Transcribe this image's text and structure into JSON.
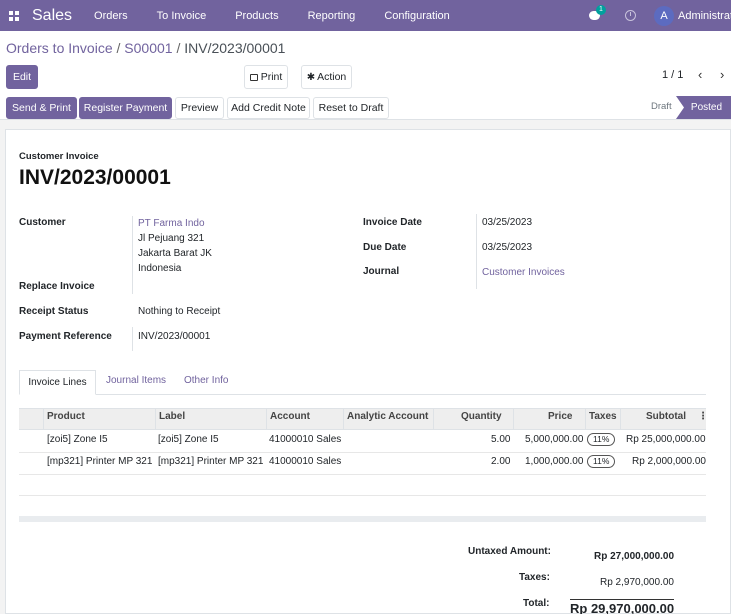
{
  "navbar": {
    "app_name": "Sales",
    "menu": [
      "Orders",
      "To Invoice",
      "Products",
      "Reporting",
      "Configuration"
    ],
    "chat_badge": "1",
    "avatar_letter": "A",
    "user_name": "Administrator",
    "color": "#71639e"
  },
  "breadcrumb": {
    "parent1": "Orders to Invoice",
    "parent2": "S00001",
    "current": "INV/2023/00001",
    "sep": "/"
  },
  "actions": {
    "edit": "Edit",
    "print": "Print",
    "action": "Action",
    "pager": "1 / 1",
    "send_print": "Send & Print",
    "register_payment": "Register Payment",
    "preview": "Preview",
    "add_credit_note": "Add Credit Note",
    "reset_to_draft": "Reset to Draft"
  },
  "status": {
    "draft": "Draft",
    "posted": "Posted"
  },
  "invoice": {
    "type_label": "Customer Invoice",
    "number": "INV/2023/00001",
    "customer_label": "Customer",
    "customer_name": "PT Farma Indo",
    "customer_addr1": "Jl Pejuang 321",
    "customer_addr2": "Jakarta Barat JK",
    "customer_addr3": "Indonesia",
    "replace_invoice_label": "Replace Invoice",
    "receipt_status_label": "Receipt Status",
    "receipt_status_value": "Nothing to Receipt",
    "payment_reference_label": "Payment Reference",
    "payment_reference_value": "INV/2023/00001",
    "invoice_date_label": "Invoice Date",
    "invoice_date_value": "03/25/2023",
    "due_date_label": "Due Date",
    "due_date_value": "03/25/2023",
    "journal_label": "Journal",
    "journal_value": "Customer Invoices"
  },
  "tabs": [
    "Invoice Lines",
    "Journal Items",
    "Other Info"
  ],
  "lines": {
    "headers": {
      "product": "Product",
      "label": "Label",
      "account": "Account",
      "analytic": "Analytic Account",
      "quantity": "Quantity",
      "price": "Price",
      "taxes": "Taxes",
      "subtotal": "Subtotal",
      "more": "⋮"
    },
    "rows": [
      {
        "product": "[zoi5] Zone I5",
        "label": "[zoi5] Zone I5",
        "account": "41000010 Sales",
        "analytic": "",
        "quantity": "5.00",
        "price": "5,000,000.00",
        "taxes": "11%",
        "subtotal": "Rp 25,000,000.00"
      },
      {
        "product": "[mp321] Printer MP 321",
        "label": "[mp321] Printer MP 321",
        "account": "41000010 Sales",
        "analytic": "",
        "quantity": "2.00",
        "price": "1,000,000.00",
        "taxes": "11%",
        "subtotal": "Rp 2,000,000.00"
      }
    ]
  },
  "totals": {
    "untaxed_label": "Untaxed Amount:",
    "untaxed_value": "Rp 27,000,000.00",
    "taxes_label": "Taxes:",
    "taxes_value": "Rp 2,970,000.00",
    "total_label": "Total:",
    "total_value": "Rp 29,970,000.00"
  }
}
